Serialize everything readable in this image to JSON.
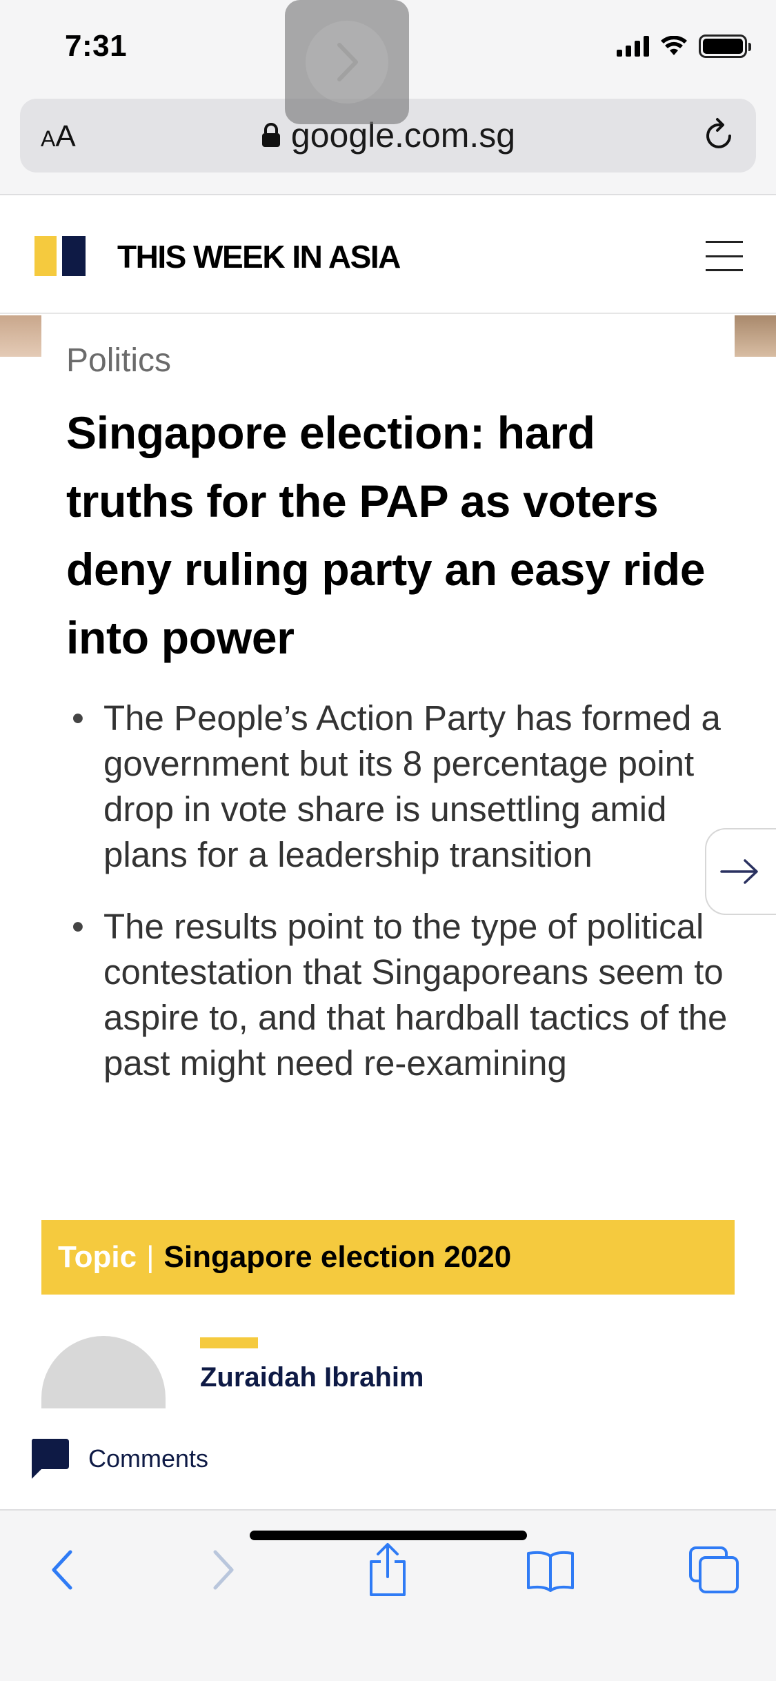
{
  "status_bar": {
    "time": "7:31"
  },
  "browser": {
    "text_size_label_small": "A",
    "text_size_label_large": "A",
    "url": "google.com.sg",
    "accent_color": "#2f7bf5"
  },
  "site": {
    "title": "THIS WEEK IN ASIA",
    "brand_colors": {
      "yellow": "#f5ca3e",
      "navy": "#0e1a45"
    }
  },
  "article": {
    "section": "Politics",
    "headline": "Singapore election: hard truths for the PAP as voters deny ruling party an easy ride into power",
    "summary": [
      "The People’s Action Party has formed a government but its 8 percentage point drop in vote share is unsettling amid plans for a leadership transition",
      "The results point to the type of political contestation that Singaporeans seem to aspire to, and that hardball tactics of the past might need re-examining"
    ],
    "topic": {
      "label": "Topic",
      "separator": "|",
      "name": "Singapore election 2020"
    },
    "author": {
      "name": "Zuraidah Ibrahim"
    }
  },
  "comments": {
    "label": "Comments"
  },
  "icons": {
    "lock": "lock-icon",
    "reload": "reload-icon",
    "menu": "hamburger-menu-icon",
    "next": "arrow-right-icon",
    "comment": "speech-bubble-icon",
    "back": "chevron-left-icon",
    "forward": "chevron-right-icon",
    "share": "share-icon",
    "bookmarks": "book-icon",
    "tabs": "tabs-icon"
  }
}
